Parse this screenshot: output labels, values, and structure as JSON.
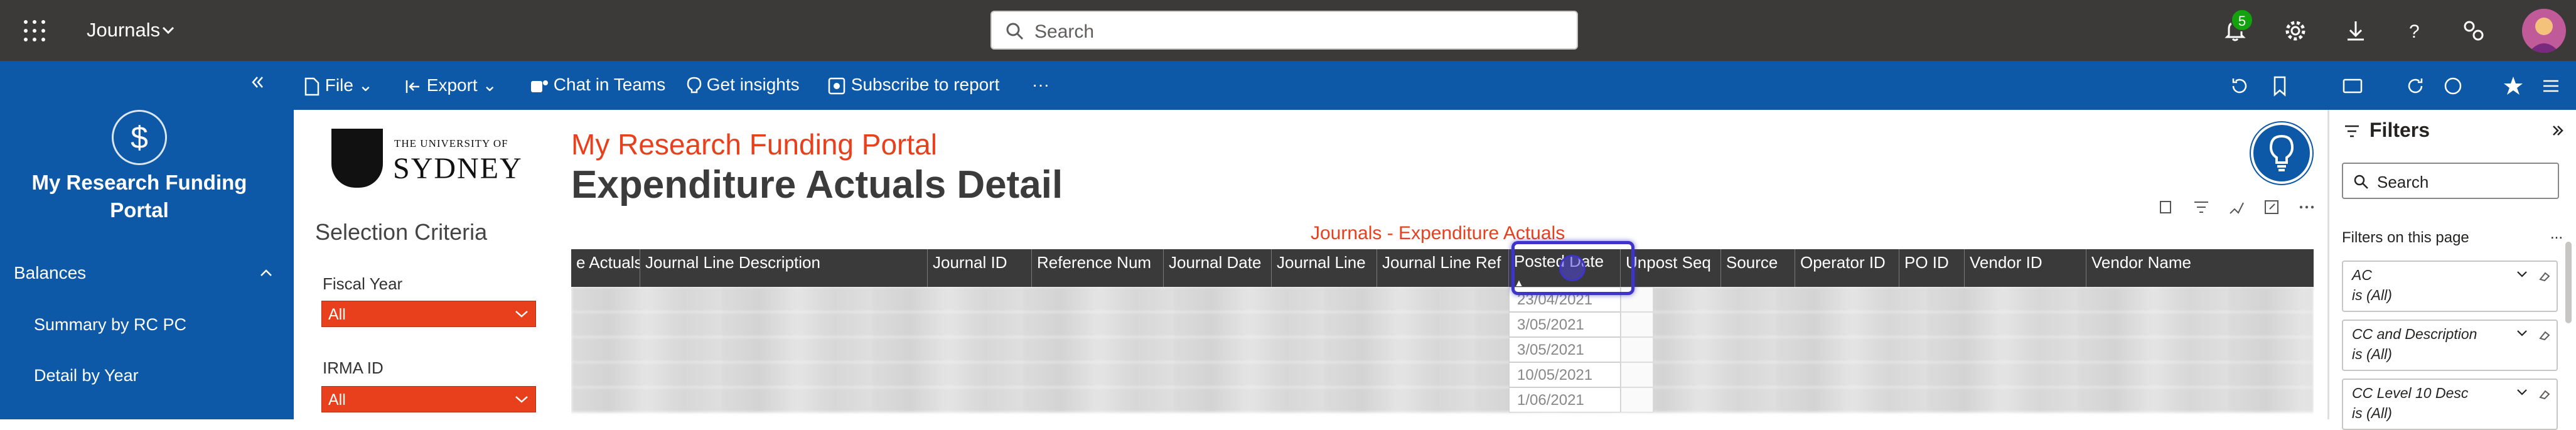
{
  "topbar": {
    "app_title": "Journals",
    "search_placeholder": "Search",
    "notification_count": "5"
  },
  "leftnav": {
    "title": "My Research Funding Portal",
    "logo_symbol": "$",
    "section": "Balances",
    "items": [
      "Summary by RC PC",
      "Detail by Year"
    ]
  },
  "commandbar": {
    "file": "File",
    "export": "Export",
    "chat": "Chat in Teams",
    "insights": "Get insights",
    "subscribe": "Subscribe to report",
    "more": "···"
  },
  "report": {
    "logo_small": "THE UNIVERSITY OF",
    "logo_big": "SYDNEY",
    "selection_title": "Selection Criteria",
    "filters": [
      {
        "label": "Fiscal Year",
        "value": "All"
      },
      {
        "label": "IRMA ID",
        "value": "All"
      }
    ],
    "portal_title": "My Research Funding Portal",
    "page_title": "Expenditure Actuals Detail",
    "table_title": "Journals - Expenditure Actuals",
    "columns": [
      "e Actuals",
      "Journal Line Description",
      "Journal ID",
      "Reference Num",
      "Journal Date",
      "Journal Line",
      "Journal Line Ref",
      "Posted Date",
      "Unpost Seq",
      "Source",
      "Operator ID",
      "PO ID",
      "Vendor ID",
      "Vendor Name"
    ],
    "sort_indicator": "▲",
    "posted_dates": [
      "23/04/2021",
      "3/05/2021",
      "3/05/2021",
      "10/05/2021",
      "1/06/2021"
    ]
  },
  "filters_pane": {
    "title": "Filters",
    "search_placeholder": "Search",
    "on_page_label": "Filters on this page",
    "more": "...",
    "cards": [
      {
        "name": "AC",
        "value": "is (All)"
      },
      {
        "name": "CC and Description",
        "value": "is (All)"
      },
      {
        "name": "CC Level 10 Desc",
        "value": "is (All)"
      }
    ]
  },
  "colors": {
    "topbar_bg": "#3b3a39",
    "brand_blue": "#0d59a8",
    "accent_orange": "#e8401c",
    "header_dark": "#3a3a3a",
    "highlight": "#3e34c9"
  }
}
